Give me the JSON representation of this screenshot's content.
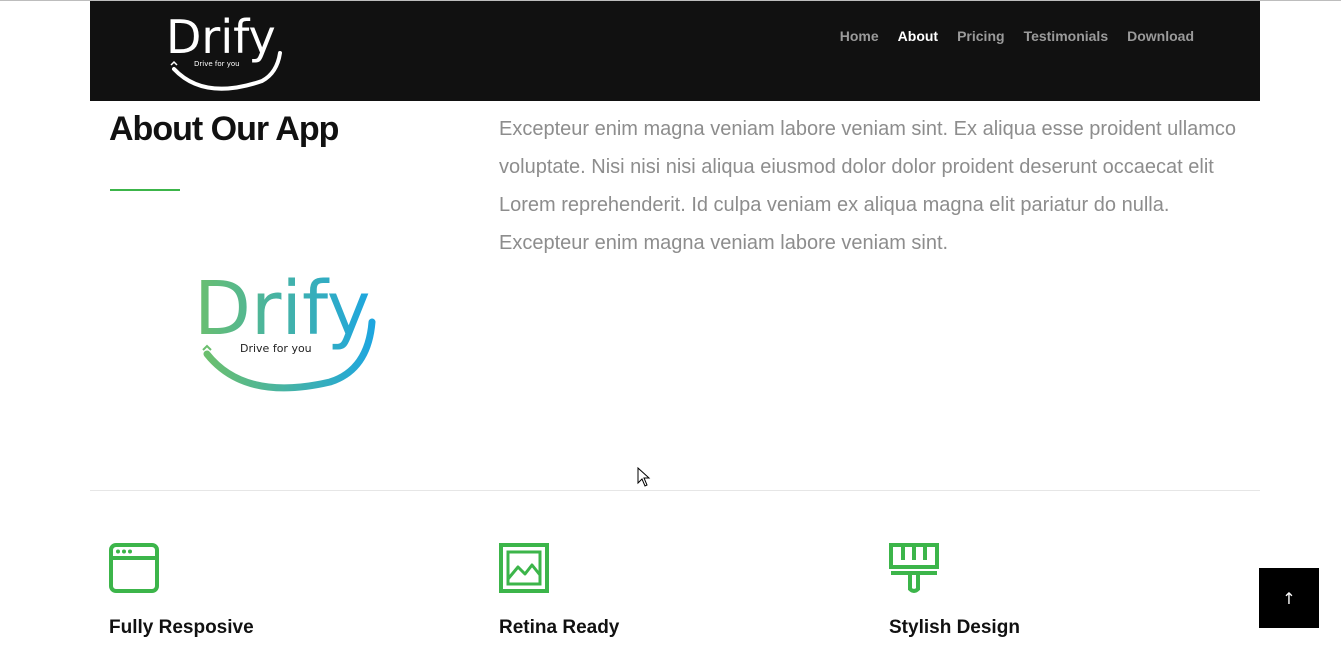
{
  "brand": {
    "name": "Drify",
    "tagline": "Drive for you"
  },
  "nav": {
    "items": [
      {
        "label": "Home",
        "active": false
      },
      {
        "label": "About",
        "active": true
      },
      {
        "label": "Pricing",
        "active": false
      },
      {
        "label": "Testimonials",
        "active": false
      },
      {
        "label": "Download",
        "active": false
      }
    ]
  },
  "about": {
    "title": "About Our App",
    "body": "Excepteur enim magna veniam labore veniam sint. Ex aliqua esse proident ullamco voluptate. Nisi nisi nisi aliqua eiusmod dolor dolor proident deserunt occaecat elit Lorem reprehenderit. Id culpa veniam ex aliqua magna elit pariatur do nulla. Excepteur enim magna veniam labore veniam sint.",
    "logo_name": "Drify",
    "logo_tagline": "Drive for you"
  },
  "features": [
    {
      "title": "Fully Resposive",
      "icon": "browser-window-icon"
    },
    {
      "title": "Retina Ready",
      "icon": "image-icon"
    },
    {
      "title": "Stylish Design",
      "icon": "paint-brush-icon"
    }
  ],
  "scroll_top": {
    "icon": "arrow-up-icon",
    "glyph": "↑"
  },
  "colors": {
    "navbar_bg": "#111111",
    "accent_green": "#3cb54a",
    "logo_green": "#6bbf6e",
    "logo_blue": "#1ea6df",
    "nav_inactive": "#9a9a9a",
    "body_text": "#8d8d8d",
    "scroll_button_bg": "#000000"
  }
}
